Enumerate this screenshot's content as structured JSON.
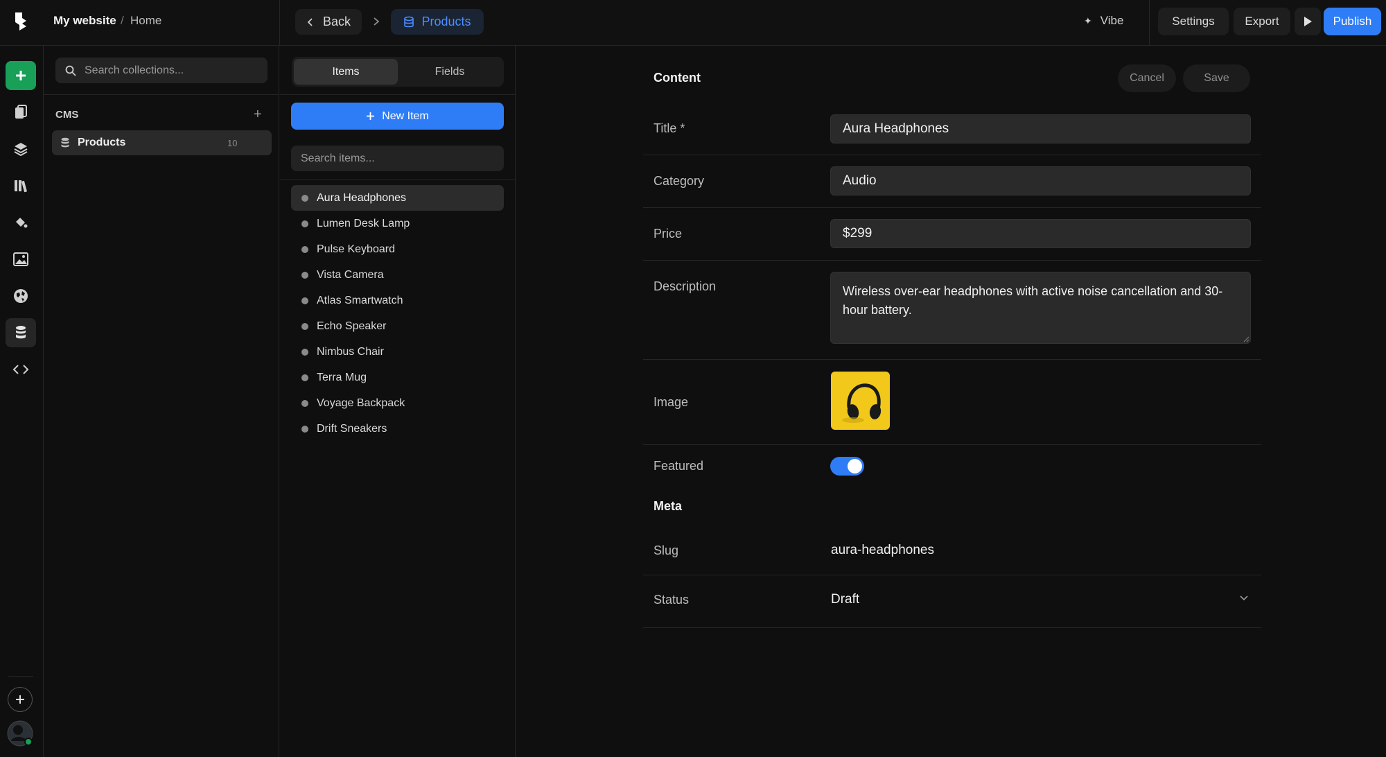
{
  "header": {
    "site": "My website",
    "separator": "/",
    "page": "Home",
    "back_label": "Back",
    "collection_tab": "Products",
    "vibe_label": "Vibe",
    "settings_label": "Settings",
    "export_label": "Export",
    "publish_label": "Publish"
  },
  "collections": {
    "search_placeholder": "Search collections...",
    "section_label": "CMS",
    "items": [
      {
        "label": "Products",
        "count": "10"
      }
    ]
  },
  "items_panel": {
    "tabs": [
      "Items",
      "Fields"
    ],
    "new_item_label": "New Item",
    "search_placeholder": "Search items...",
    "items": [
      "Aura Headphones",
      "Lumen Desk Lamp",
      "Pulse Keyboard",
      "Vista Camera",
      "Atlas Smartwatch",
      "Echo Speaker",
      "Nimbus Chair",
      "Terra Mug",
      "Voyage Backpack",
      "Drift Sneakers"
    ],
    "selected_index": 0
  },
  "editor": {
    "content_heading": "Content",
    "cancel_label": "Cancel",
    "save_label": "Save",
    "fields": {
      "title_label": "Title *",
      "title_value": "Aura Headphones",
      "category_label": "Category",
      "category_value": "Audio",
      "price_label": "Price",
      "price_value": "$299",
      "description_label": "Description",
      "description_value": "Wireless over-ear headphones with active noise cancellation and 30-hour battery.",
      "image_label": "Image",
      "featured_label": "Featured",
      "featured_value": true
    },
    "meta_heading": "Meta",
    "meta": {
      "slug_label": "Slug",
      "slug_value": "aura-headphones",
      "status_label": "Status",
      "status_value": "Draft"
    }
  },
  "colors": {
    "accent": "#2f7df6",
    "add_button": "#18a058",
    "background": "#0f0f0f",
    "image_bg": "#f2c81a"
  }
}
